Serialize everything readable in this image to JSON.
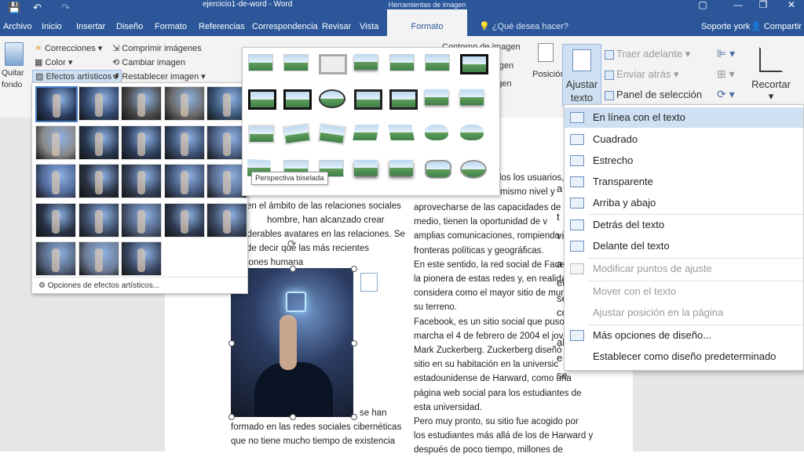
{
  "titlebar": {
    "doc_title": "ejercicio1-de-word - Word",
    "context_title": "Herramientas de imagen",
    "save_icon": "save-icon",
    "undo_icon": "undo-icon",
    "redo_icon": "redo-icon",
    "window_buttons": [
      "▢",
      "—",
      "❐",
      "✕"
    ]
  },
  "tabs": [
    "Archivo",
    "Inicio",
    "Insertar",
    "Diseño",
    "Formato",
    "Referencias",
    "Correspondencia",
    "Revisar",
    "Vista",
    "Formato"
  ],
  "tellme": "¿Qué desea hacer?",
  "account": "Soporte york",
  "share": "Compartir",
  "ribbon": {
    "quitar_fondo": "Quitar fondo",
    "correcciones": "Correcciones",
    "color": "Color",
    "efectos": "Efectos artísticos",
    "comprimir": "Comprimir imágenes",
    "cambiar": "Cambiar imagen",
    "restablecer": "Restablecer imagen",
    "contorno": "Contorno de imagen",
    "efectos_img": "Efectos de imagen",
    "diseno_img": "Diseño de imagen",
    "posicion": "Posición",
    "ajustar": "Ajustar texto",
    "traer": "Traer adelante",
    "enviar": "Enviar atrás",
    "panel": "Panel de selección",
    "recortar": "Recortar"
  },
  "effects_options": "Opciones de efectos artísticos...",
  "tooltip": "Perspectiva biselada",
  "wrap_menu": {
    "items": [
      "En línea con el texto",
      "Cuadrado",
      "Estrecho",
      "Transparente",
      "Arriba y abajo",
      "Detrás del texto",
      "Delante del texto"
    ],
    "modificar": "Modificar puntos de ajuste",
    "mover": "Mover con el texto",
    "fijar": "Ajustar posición en la página",
    "mas": "Más opciones de diseño...",
    "establecer": "Establecer como diseño predeterminado"
  },
  "doc": {
    "left_col": [
      "en el ámbito de las relaciones sociales",
      "hombre,    han    alcanzado    crear",
      "iderables avatares en las relaciones. Se",
      "de    decir    que    las    más    recientes",
      "iones                               humana"
    ],
    "left_bottom": [
      "se han",
      "formado en las redes sociales cibernéticas",
      "que no tiene mucho tiempo de existencia"
    ],
    "right_top": [
      "dos los usuarios,",
      "mismo nivel y"
    ],
    "right_col": [
      "aprovecharse de las capacidades de e",
      "medio, tienen la oportunidad de v",
      "amplias comunicaciones, rompiendo",
      "fronteras políticas y geográficas.",
      "En este sentido, la red social de Facebook",
      "la pionera de estas redes y, en realidad,",
      "considera como el mayor sitio de mundo",
      "su terreno.",
      "Facebook, es un sitio social que puso",
      "marcha el 4 de febrero de 2004 el jov",
      "Mark Zuckerberg. Zuckerberg diseñó e",
      "sitio en su habitación en la universic",
      "estadounidense de Harward, como una",
      "página web social para los estudiantes de",
      "esta universidad.",
      "Pero muy pronto, su sitio fue acogido por",
      "los estudiantes más allá de los de Harward y",
      "después de poco tiempo, millones de"
    ],
    "margin_letters": [
      "a",
      "t",
      "vi",
      "a",
      "el",
      "se",
      "co",
      "al",
      "e",
      "se"
    ]
  }
}
